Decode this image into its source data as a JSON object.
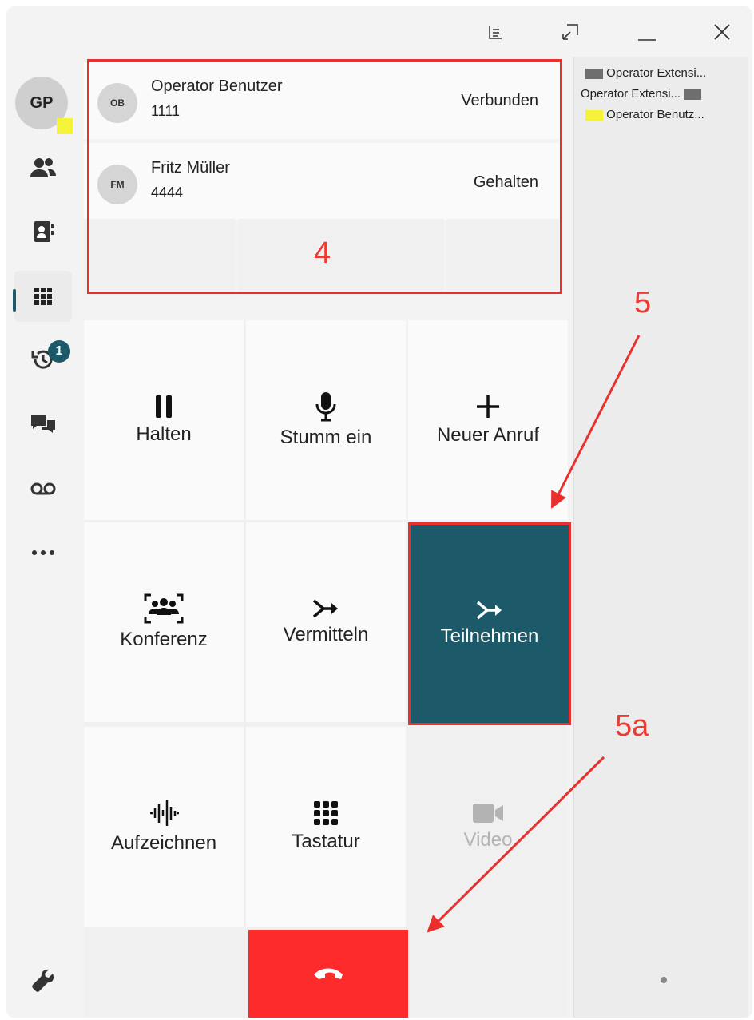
{
  "window": {
    "controls": [
      "list-icon",
      "restore-icon",
      "minimize-icon",
      "close-icon"
    ]
  },
  "sidebar": {
    "avatar_initials": "GP",
    "presence_color": "#f5f23a",
    "items": [
      {
        "name": "contacts",
        "icon": "people-icon"
      },
      {
        "name": "phonebook",
        "icon": "address-book-icon"
      },
      {
        "name": "dialpad",
        "icon": "dialpad-icon",
        "active": true
      },
      {
        "name": "history",
        "icon": "history-icon",
        "badge": "1"
      },
      {
        "name": "chat",
        "icon": "chat-icon"
      },
      {
        "name": "voicemail",
        "icon": "voicemail-icon"
      },
      {
        "name": "more",
        "icon": "more-icon"
      },
      {
        "name": "settings",
        "icon": "wrench-icon"
      }
    ]
  },
  "calls": [
    {
      "initials": "OB",
      "name": "Operator Benutzer",
      "number": "1111",
      "status": "Verbunden"
    },
    {
      "initials": "FM",
      "name": "Fritz Müller",
      "number": "4444",
      "status": "Gehalten"
    }
  ],
  "actions": {
    "hold": "Halten",
    "mute": "Stumm ein",
    "new_call": "Neuer Anruf",
    "conference": "Konferenz",
    "transfer": "Vermitteln",
    "join": "Teilnehmen",
    "record": "Aufzeichnen",
    "keypad": "Tastatur",
    "video": "Video"
  },
  "hangup_icon": "hangup-icon",
  "right_panel": {
    "items": [
      {
        "label": "Operator Extensi...",
        "color": "#6e6e6e",
        "swatch_side": "left"
      },
      {
        "label": "Operator Extensi...",
        "color": "#6e6e6e",
        "swatch_side": "right"
      },
      {
        "label": "Operator Benutz...",
        "color": "#f5f23a",
        "swatch_side": "left"
      }
    ]
  },
  "annotations": {
    "label_4": "4",
    "label_5": "5",
    "label_5a": "5a",
    "color": "#e8302c"
  },
  "colors": {
    "accent": "#1d5a69",
    "hangup": "#fd2b2b"
  }
}
